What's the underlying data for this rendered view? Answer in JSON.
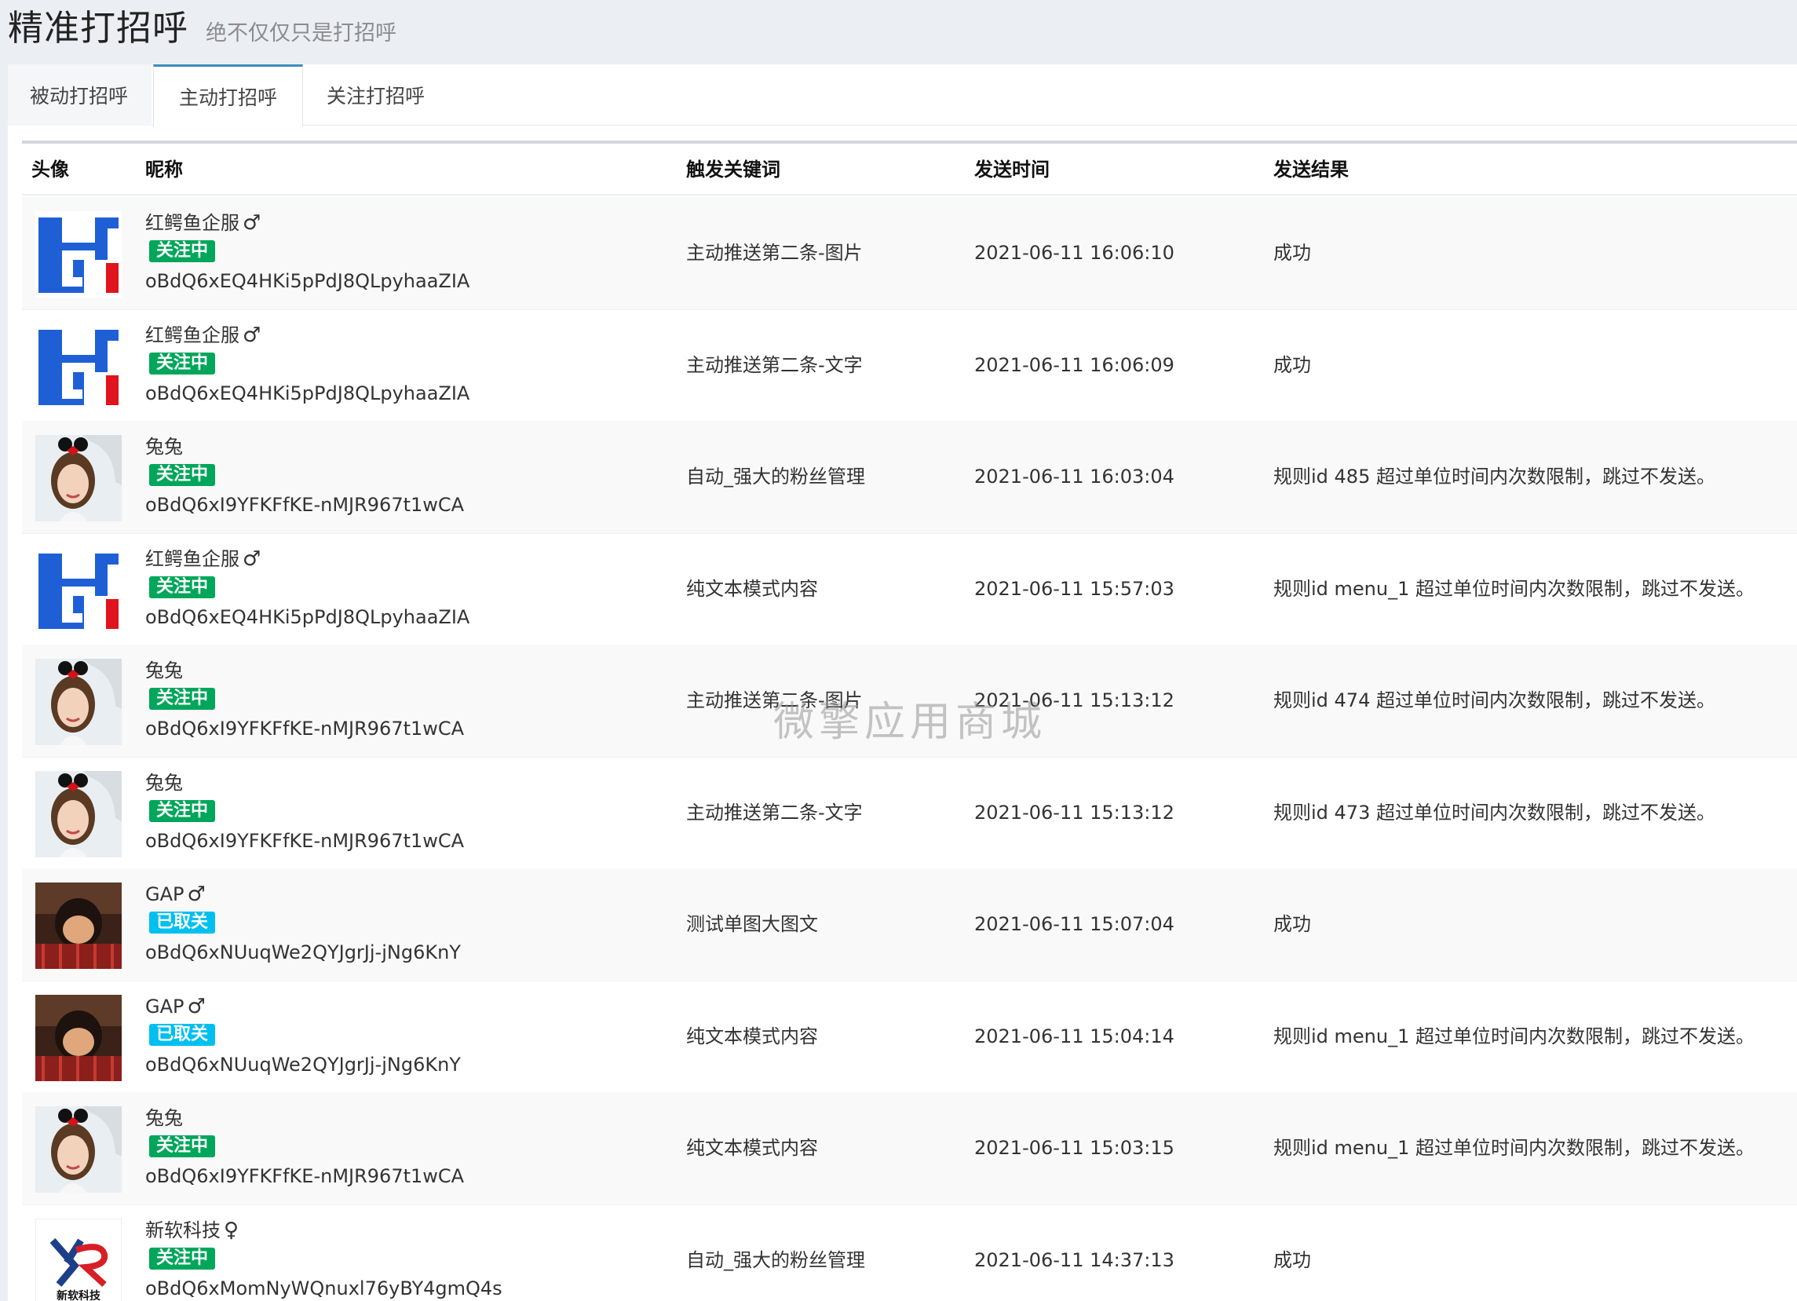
{
  "header": {
    "title": "精准打招呼",
    "subtitle": "绝不仅仅只是打招呼"
  },
  "tabs": [
    {
      "label": "被动打招呼"
    },
    {
      "label": "主动打招呼"
    },
    {
      "label": "关注打招呼"
    }
  ],
  "table": {
    "headers": {
      "avatar": "头像",
      "nickname": "昵称",
      "keyword": "触发关键词",
      "time": "发送时间",
      "result": "发送结果"
    },
    "rows": [
      {
        "avatar": "hongeyu-logo",
        "nickname": "红鳄鱼企服",
        "gender": "♂",
        "status": "关注中",
        "openid": "oBdQ6xEQ4HKi5pPdJ8QLpyhaaZIA",
        "keyword": "主动推送第二条-图片",
        "time": "2021-06-11 16:06:10",
        "result": "成功"
      },
      {
        "avatar": "hongeyu-logo",
        "nickname": "红鳄鱼企服",
        "gender": "♂",
        "status": "关注中",
        "openid": "oBdQ6xEQ4HKi5pPdJ8QLpyhaaZIA",
        "keyword": "主动推送第二条-文字",
        "time": "2021-06-11 16:06:09",
        "result": "成功"
      },
      {
        "avatar": "girl-photo",
        "nickname": "兔兔",
        "gender": "",
        "status": "关注中",
        "openid": "oBdQ6xI9YFKFfKE-nMJR967t1wCA",
        "keyword": "自动_强大的粉丝管理",
        "time": "2021-06-11 16:03:04",
        "result": "规则id 485 超过单位时间内次数限制，跳过不发送。"
      },
      {
        "avatar": "hongeyu-logo",
        "nickname": "红鳄鱼企服",
        "gender": "♂",
        "status": "关注中",
        "openid": "oBdQ6xEQ4HKi5pPdJ8QLpyhaaZIA",
        "keyword": "纯文本模式内容",
        "time": "2021-06-11 15:57:03",
        "result": "规则id menu_1 超过单位时间内次数限制，跳过不发送。"
      },
      {
        "avatar": "girl-photo",
        "nickname": "兔兔",
        "gender": "",
        "status": "关注中",
        "openid": "oBdQ6xI9YFKFfKE-nMJR967t1wCA",
        "keyword": "主动推送第二条-图片",
        "time": "2021-06-11 15:13:12",
        "result": "规则id 474 超过单位时间内次数限制，跳过不发送。"
      },
      {
        "avatar": "girl-photo",
        "nickname": "兔兔",
        "gender": "",
        "status": "关注中",
        "openid": "oBdQ6xI9YFKFfKE-nMJR967t1wCA",
        "keyword": "主动推送第二条-文字",
        "time": "2021-06-11 15:13:12",
        "result": "规则id 473 超过单位时间内次数限制，跳过不发送。"
      },
      {
        "avatar": "anime-photo",
        "nickname": "GAP",
        "gender": "♂",
        "status": "已取关",
        "openid": "oBdQ6xNUuqWe2QYJgrJj-jNg6KnY",
        "keyword": "测试单图大图文",
        "time": "2021-06-11 15:07:04",
        "result": "成功"
      },
      {
        "avatar": "anime-photo",
        "nickname": "GAP",
        "gender": "♂",
        "status": "已取关",
        "openid": "oBdQ6xNUuqWe2QYJgrJj-jNg6KnY",
        "keyword": "纯文本模式内容",
        "time": "2021-06-11 15:04:14",
        "result": "规则id menu_1 超过单位时间内次数限制，跳过不发送。"
      },
      {
        "avatar": "girl-photo",
        "nickname": "兔兔",
        "gender": "",
        "status": "关注中",
        "openid": "oBdQ6xI9YFKFfKE-nMJR967t1wCA",
        "keyword": "纯文本模式内容",
        "time": "2021-06-11 15:03:15",
        "result": "规则id menu_1 超过单位时间内次数限制，跳过不发送。"
      },
      {
        "avatar": "xinruan-logo",
        "nickname": "新软科技",
        "gender": "♀",
        "status": "关注中",
        "openid": "oBdQ6xMomNyWQnuxl76yBY4gmQ4s",
        "keyword": "自动_强大的粉丝管理",
        "time": "2021-06-11 14:37:13",
        "result": "成功"
      }
    ]
  },
  "watermark": "微擎应用商城",
  "avatar_logo_text": "新软科技",
  "colors": {
    "follow": "#00a65a",
    "unfollow": "#00c0ef",
    "accent": "#3c8dbc"
  }
}
